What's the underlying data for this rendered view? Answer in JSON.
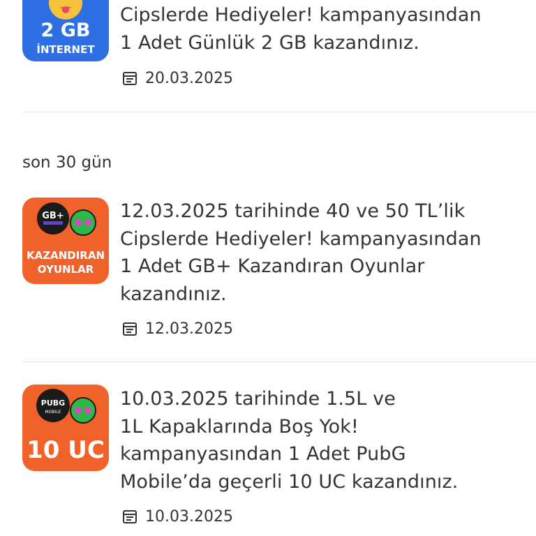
{
  "items": [
    {
      "badge_top": "2 GB",
      "badge_bottom": "İNTERNET",
      "lines": [
        "Cipslerde Hediyeler! kampanyasından",
        "1 Adet Günlük 2 GB kazandınız."
      ],
      "date": "20.03.2025",
      "badge_color": "#2f6fe4"
    },
    {
      "badge_top": "KAZANDIRAN",
      "badge_bottom": "OYUNLAR",
      "badge_logo": "GB+",
      "lines": [
        "12.03.2025 tarihinde 40 ve 50 TL’lik",
        "Cipslerde Hediyeler! kampanyasından",
        "1 Adet GB+ Kazandıran Oyunlar",
        "kazandınız."
      ],
      "date": "12.03.2025",
      "badge_color": "#f0622a"
    },
    {
      "badge_top": "10 UC",
      "badge_logo": "PUBG",
      "badge_logo_sub": "MOBILE",
      "lines": [
        "10.03.2025 tarihinde 1.5L ve",
        "1L Kapaklarında Boş Yok!",
        "kampanyasından 1 Adet PubG",
        "Mobile’da geçerli 10 UC kazandınız."
      ],
      "date": "10.03.2025",
      "badge_color": "#f0622a"
    }
  ],
  "section_label": "son 30 gün",
  "icons": {
    "date": "calendar-icon",
    "controller": "game-controller-icon"
  }
}
